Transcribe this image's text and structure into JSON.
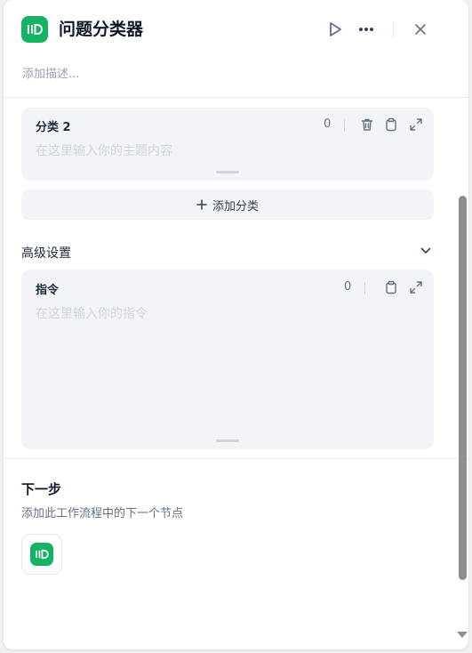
{
  "header": {
    "title": "问题分类器",
    "description_placeholder": "添加描述..."
  },
  "classes": [
    {
      "title": "分类 2",
      "count": "0",
      "placeholder": "在这里输入你的主题内容"
    }
  ],
  "add_class_label": "添加分类",
  "advanced": {
    "label": "高级设置",
    "instruction_title": "指令",
    "instruction_count": "0",
    "instruction_placeholder": "在这里输入你的指令"
  },
  "next_step": {
    "title": "下一步",
    "description": "添加此工作流程中的下一个节点"
  },
  "colors": {
    "accent": "#16b364",
    "card_background": "#f2f4f7"
  },
  "icons": [
    "classifier-icon",
    "play-icon",
    "more-icon",
    "close-icon",
    "trash-icon",
    "clipboard-icon",
    "expand-icon",
    "plus-icon",
    "chevron-down-icon"
  ]
}
